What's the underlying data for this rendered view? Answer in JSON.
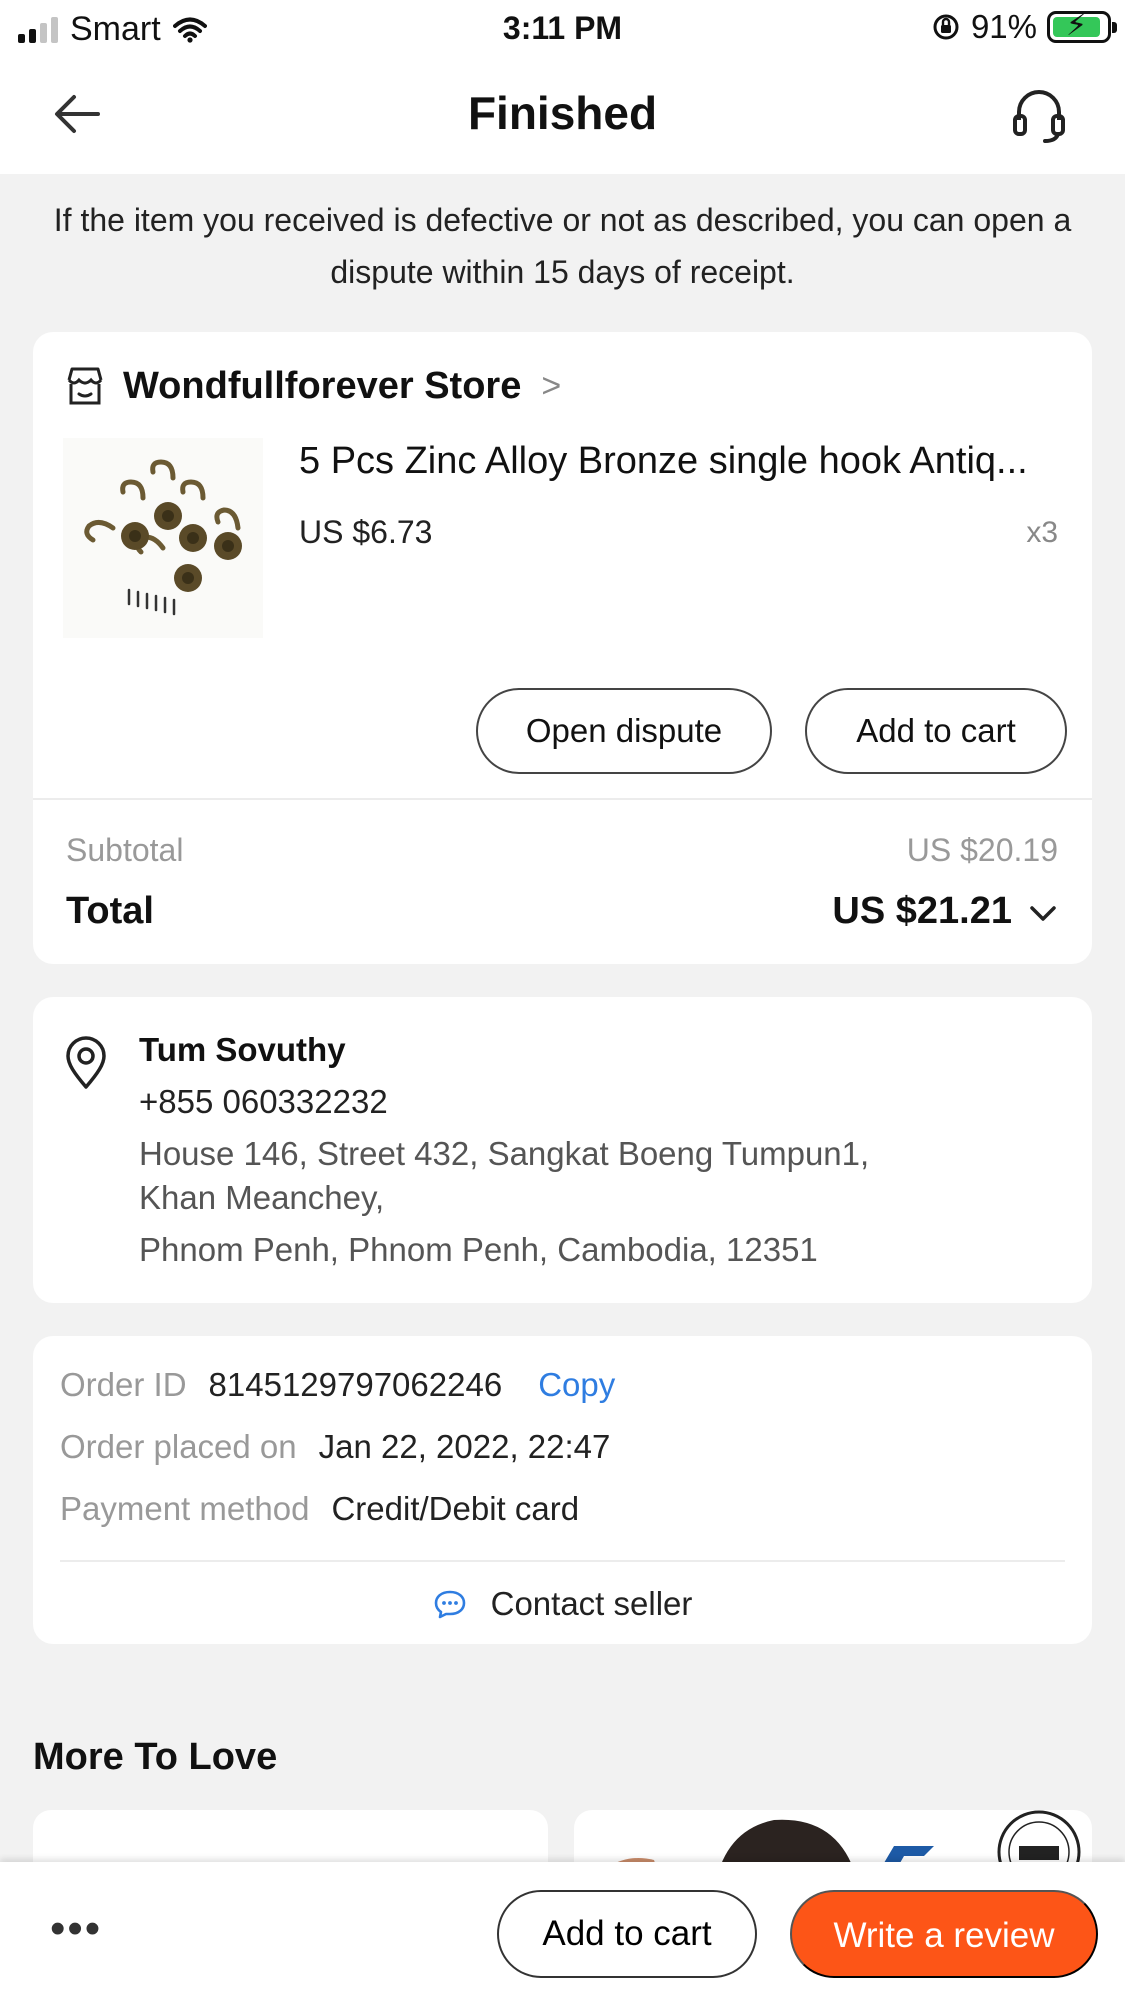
{
  "status_bar": {
    "carrier": "Smart",
    "time": "3:11 PM",
    "battery": "91%",
    "battery_level": 0.91,
    "signal_bars_filled": 2,
    "signal_bars_total": 4
  },
  "header": {
    "title": "Finished"
  },
  "notice": "If the item you received is defective or not as described, you can open a dispute within 15 days of receipt.",
  "order": {
    "store_name": "Wondfullforever Store",
    "product": {
      "title": "5 Pcs Zinc Alloy Bronze single hook Antiq...",
      "price": "US $6.73",
      "quantity": "x3"
    },
    "buttons": {
      "open_dispute": "Open dispute",
      "add_to_cart": "Add to cart"
    },
    "subtotal_label": "Subtotal",
    "subtotal_value": "US $20.19",
    "total_label": "Total",
    "total_value": "US $21.21"
  },
  "address": {
    "name": "Tum Sovuthy",
    "phone": "+855 060332232",
    "line1": "House 146, Street 432, Sangkat Boeng Tumpun1,",
    "line2": "Khan Meanchey,",
    "line3": "Phnom Penh, Phnom Penh, Cambodia, 12351"
  },
  "details": {
    "order_id_label": "Order ID",
    "order_id": "8145129797062246",
    "copy": "Copy",
    "placed_label": "Order placed on",
    "placed_value": "Jan 22, 2022, 22:47",
    "payment_label": "Payment method",
    "payment_value": "Credit/Debit card",
    "contact_seller": "Contact seller"
  },
  "more_to_love": {
    "title": "More To Love"
  },
  "bottom_bar": {
    "add_to_cart": "Add to cart",
    "write_review": "Write a review"
  },
  "colors": {
    "accent_orange": "#fd5517",
    "link_blue": "#2f7de1",
    "battery_green": "#34c759"
  }
}
